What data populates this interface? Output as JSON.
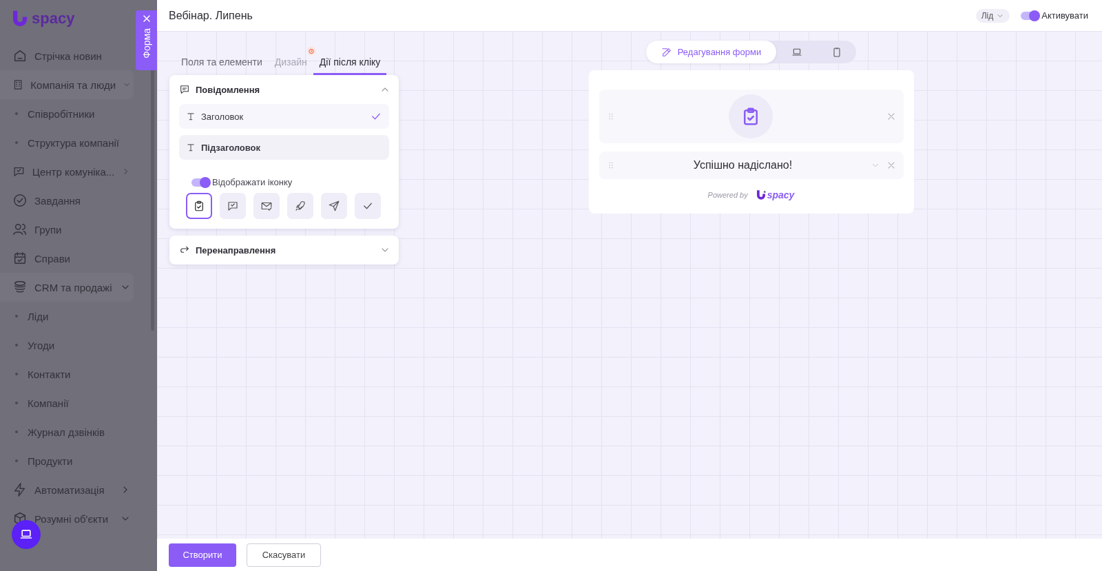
{
  "sidebar": {
    "logo": "spacy",
    "items": [
      {
        "label": "Стрічка новин",
        "kind": "link"
      },
      {
        "label": "Компанія та люди",
        "kind": "group",
        "expanded": true,
        "children": [
          {
            "label": "Співробітники"
          },
          {
            "label": "Структура компанії"
          }
        ]
      },
      {
        "label": "Центр комуніка...",
        "kind": "group",
        "expanded": false
      },
      {
        "label": "Завдання",
        "kind": "link"
      },
      {
        "label": "Групи",
        "kind": "link"
      },
      {
        "label": "Справи",
        "kind": "link"
      },
      {
        "label": "CRM та продажі",
        "kind": "group",
        "expanded": true,
        "children": [
          {
            "label": "Ліди"
          },
          {
            "label": "Угоди"
          },
          {
            "label": "Контакти"
          },
          {
            "label": "Компанії"
          },
          {
            "label": "Журнал дзвінків"
          },
          {
            "label": "Продукти"
          }
        ]
      },
      {
        "label": "Автоматизація",
        "kind": "group",
        "expanded": false
      },
      {
        "label": "Розумні об'єкти",
        "kind": "group",
        "expanded": true
      }
    ]
  },
  "drawer_tab": {
    "label": "Форма"
  },
  "header": {
    "title": "Вебінар. Липень",
    "entity": "Лід",
    "activate": {
      "label": "Активувати",
      "on": true
    }
  },
  "tabs": [
    {
      "label": "Поля та елементи",
      "selected": false,
      "disabled": false,
      "alert": false
    },
    {
      "label": "Дизайн",
      "selected": false,
      "disabled": true,
      "alert": true
    },
    {
      "label": "Дії після кліку",
      "selected": true,
      "disabled": false,
      "alert": false
    }
  ],
  "sections": [
    {
      "title": "Повідомлення",
      "expanded": true,
      "fields": [
        {
          "label": "Заголовок",
          "checked": true
        },
        {
          "label": "Підзаголовок",
          "checked": false
        }
      ],
      "show_icon": {
        "label": "Відображати іконку",
        "on": true
      },
      "icons": [
        {
          "kind": "clipboard",
          "selected": true
        },
        {
          "kind": "chat",
          "selected": false
        },
        {
          "kind": "mail",
          "selected": false
        },
        {
          "kind": "rocket",
          "selected": false
        },
        {
          "kind": "send",
          "selected": false
        },
        {
          "kind": "check",
          "selected": false
        }
      ]
    },
    {
      "title": "Перенаправлення",
      "expanded": false
    }
  ],
  "preview": {
    "modes": [
      {
        "kind": "edit",
        "label": "Редагування форми",
        "selected": true
      },
      {
        "kind": "laptop",
        "selected": false
      },
      {
        "kind": "phone",
        "selected": false
      }
    ],
    "message": "Успішно надіслано!",
    "powered_by": "Powered by",
    "brand": "spacy"
  },
  "footer": {
    "buttons": [
      {
        "label": "Створити",
        "kind": "primary"
      },
      {
        "label": "Скасувати",
        "kind": "secondary"
      }
    ]
  }
}
